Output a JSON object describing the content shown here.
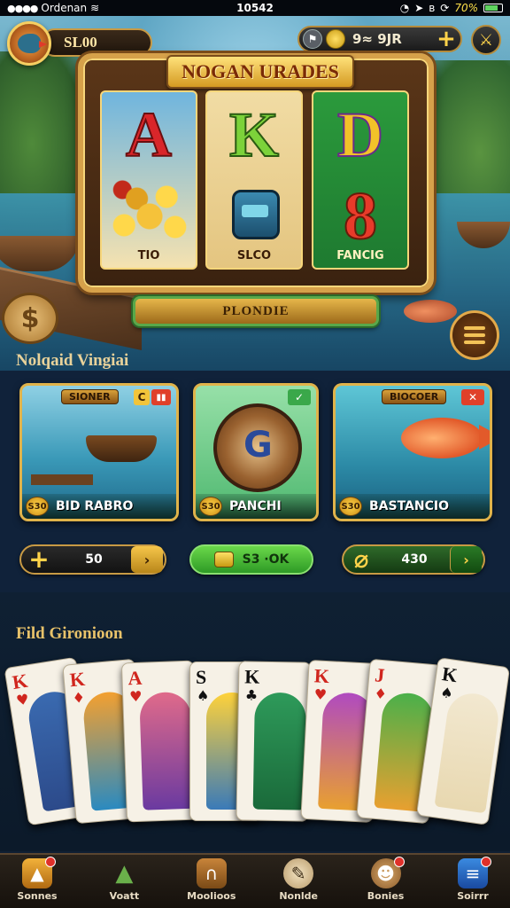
{
  "status_bar": {
    "carrier": "Ordenan",
    "time": "10542",
    "battery_pct": "70%"
  },
  "hud": {
    "balance": "SL00",
    "coins": "9≈ 9JR",
    "plus": "+",
    "settings_glyph": "⚔"
  },
  "slot": {
    "title": "NOGAN URADES",
    "reels": [
      {
        "symbol": "A",
        "label": "TIO"
      },
      {
        "symbol": "K",
        "label": "SLCO"
      },
      {
        "symbol": "D",
        "symbol_2": "8",
        "label": "FANCIG"
      }
    ],
    "play_label": "PLONDIE",
    "dollar": "$"
  },
  "section_games": {
    "title": "Nolqaid Vingiai",
    "games": [
      {
        "tag": "SIONER",
        "corner": "C",
        "corner2": "▮▮",
        "badge": "S30",
        "name": "BID RABRO"
      },
      {
        "corner": "✓",
        "badge": "S30",
        "name": "PANCHI"
      },
      {
        "tag": "BIOCOER",
        "corner": "✕",
        "badge": "S30",
        "name": "BASTANCIO"
      }
    ],
    "bets": [
      {
        "left": "+",
        "value": "50",
        "right": "›"
      },
      {
        "value": "S3 ·OK"
      },
      {
        "left": "⌀",
        "value": "430",
        "right": "›"
      }
    ]
  },
  "section_cards": {
    "title": "Fild Gironioon",
    "cards": [
      {
        "rank": "K",
        "suit": "♥",
        "color": "red"
      },
      {
        "rank": "K",
        "suit": "♦",
        "color": "red"
      },
      {
        "rank": "A",
        "suit": "♥",
        "color": "red"
      },
      {
        "rank": "S",
        "suit": "♠",
        "color": "blk"
      },
      {
        "rank": "K",
        "suit": "♣",
        "color": "blk"
      },
      {
        "rank": "K",
        "suit": "♥",
        "color": "red"
      },
      {
        "rank": "J",
        "suit": "♦",
        "color": "red"
      },
      {
        "rank": "K",
        "suit": "♠",
        "color": "blk"
      }
    ]
  },
  "nav": {
    "items": [
      {
        "label": "Sonnes",
        "glyph": "▲"
      },
      {
        "label": "Voatt",
        "glyph": "▲"
      },
      {
        "label": "Moolioos",
        "glyph": "∩"
      },
      {
        "label": "Nonlde",
        "glyph": "✎"
      },
      {
        "label": "Bonies",
        "glyph": "☻"
      },
      {
        "label": "Soirrr",
        "glyph": "≡"
      }
    ]
  },
  "colors": {
    "gold": "#d6a14a",
    "bg_dark": "#0f1f33",
    "green_btn": "#2e9a26",
    "badge_red": "#e0302a"
  }
}
